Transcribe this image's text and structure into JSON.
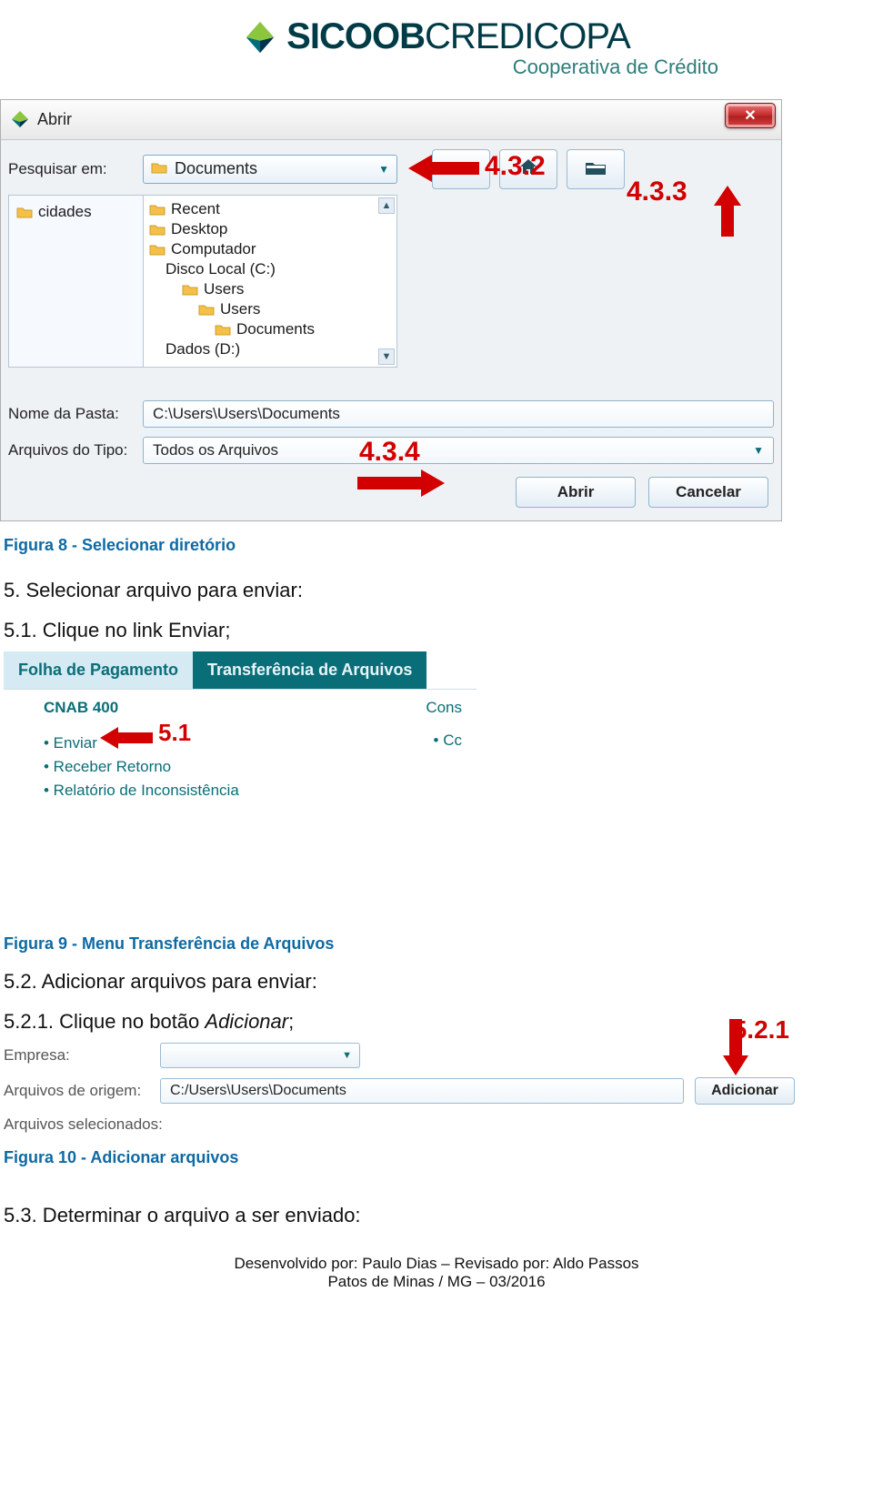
{
  "brand": {
    "name_prefix": "SICOOB",
    "name_suffix": "CREDICOPA",
    "subtitle": "Cooperativa de Crédito"
  },
  "file_dialog": {
    "title": "Abrir",
    "search_in_label": "Pesquisar em:",
    "search_in_value": "Documents",
    "toolbar_up_icon": "folder-up",
    "toolbar_home_icon": "home",
    "toolbar_new_icon": "new-folder",
    "side_items": [
      "cidades"
    ],
    "tree": [
      {
        "label": "Recent",
        "indent": 1,
        "icon": "folder"
      },
      {
        "label": "Desktop",
        "indent": 1,
        "icon": "folder"
      },
      {
        "label": "Computador",
        "indent": 1,
        "icon": "folder"
      },
      {
        "label": "Disco Local (C:)",
        "indent": 2,
        "icon": "none"
      },
      {
        "label": "Users",
        "indent": 3,
        "icon": "folder"
      },
      {
        "label": "Users",
        "indent": 4,
        "icon": "folder"
      },
      {
        "label": "Documents",
        "indent": 5,
        "icon": "folder"
      },
      {
        "label": "Dados (D:)",
        "indent": 2,
        "icon": "none"
      }
    ],
    "folder_name_label": "Nome da Pasta:",
    "folder_name_value": "C:\\Users\\Users\\Documents",
    "file_type_label": "Arquivos do Tipo:",
    "file_type_value": "Todos os Arquivos",
    "open_btn": "Abrir",
    "cancel_btn": "Cancelar"
  },
  "callouts": {
    "c432": "4.3.2",
    "c433": "4.3.3",
    "c434": "4.3.4",
    "c51": "5.1",
    "c521": "5.2.1"
  },
  "captions": {
    "fig8": "Figura 8 - Selecionar diretório",
    "fig9": "Figura 9 - Menu Transferência de Arquivos",
    "fig10": "Figura 10 - Adicionar arquivos"
  },
  "steps": {
    "s5": "5. Selecionar arquivo para enviar:",
    "s51": "5.1. Clique no link Enviar;",
    "s52": "5.2. Adicionar arquivos para enviar:",
    "s521_pre": "5.2.1. Clique no botão ",
    "s521_em": "Adicionar",
    "s521_post": ";",
    "s53": "5.3. Determinar o arquivo a ser enviado:"
  },
  "tabs_shot": {
    "tab_inactive": "Folha de Pagamento",
    "tab_active": "Transferência de Arquivos",
    "cnab": "CNAB 400",
    "links": [
      "• Enviar",
      "• Receber Retorno",
      "• Relatório de Inconsistência"
    ],
    "cons": "Cons",
    "cc": "• Cc"
  },
  "add_panel": {
    "empresa_label": "Empresa:",
    "origem_label": "Arquivos de origem:",
    "origem_value": "C:/Users\\Users\\Documents",
    "add_btn": "Adicionar",
    "selected_label": "Arquivos selecionados:"
  },
  "footer": {
    "line1": "Desenvolvido por: Paulo Dias – Revisado por: Aldo Passos",
    "line2": "Patos de Minas / MG – 03/2016"
  }
}
